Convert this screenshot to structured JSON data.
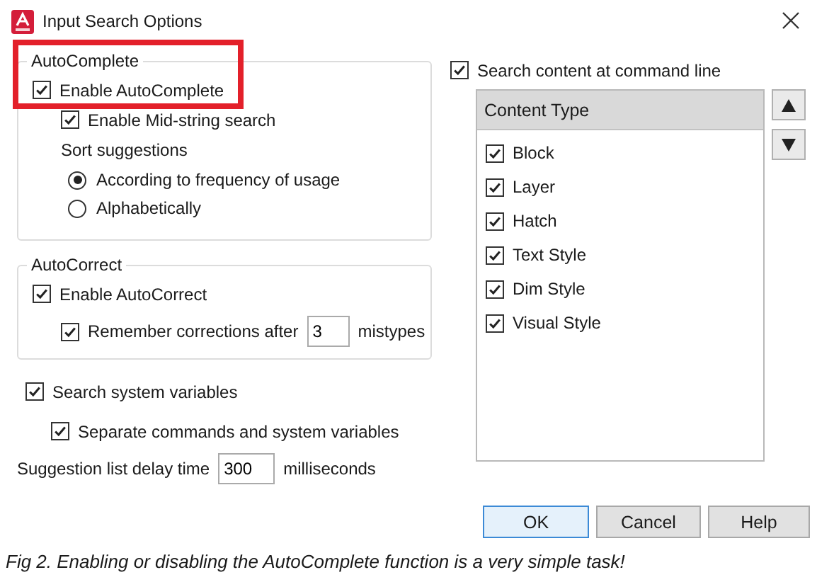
{
  "window": {
    "title": "Input Search Options"
  },
  "autocomplete": {
    "legend": "AutoComplete",
    "highlighted": true,
    "enable": {
      "label": "Enable AutoComplete",
      "checked": true
    },
    "mid_string": {
      "label": "Enable Mid-string search",
      "checked": true
    },
    "sort_label": "Sort suggestions",
    "sort_options": [
      {
        "label": "According to frequency of usage",
        "selected": true
      },
      {
        "label": "Alphabetically",
        "selected": false
      }
    ]
  },
  "autocorrect": {
    "legend": "AutoCorrect",
    "enable": {
      "label": "Enable AutoCorrect",
      "checked": true
    },
    "remember": {
      "label": "Remember corrections after",
      "checked": true,
      "value": "3",
      "suffix": "mistypes"
    }
  },
  "search_system_variables": {
    "label": "Search system variables",
    "checked": true
  },
  "separate": {
    "label": "Separate commands and system variables",
    "checked": true
  },
  "delay": {
    "label": "Suggestion list delay time",
    "value": "300",
    "suffix": "milliseconds"
  },
  "search_content": {
    "label": "Search content at command line",
    "checked": true
  },
  "content_types": {
    "header": "Content Type",
    "items": [
      {
        "label": "Block",
        "checked": true
      },
      {
        "label": "Layer",
        "checked": true
      },
      {
        "label": "Hatch",
        "checked": true
      },
      {
        "label": "Text Style",
        "checked": true
      },
      {
        "label": "Dim Style",
        "checked": true
      },
      {
        "label": "Visual Style",
        "checked": true
      }
    ]
  },
  "buttons": [
    {
      "label": "OK",
      "default": true
    },
    {
      "label": "Cancel",
      "default": false
    },
    {
      "label": "Help",
      "default": false
    }
  ],
  "caption": "Fig 2. Enabling or disabling the AutoComplete function is a very simple task!"
}
